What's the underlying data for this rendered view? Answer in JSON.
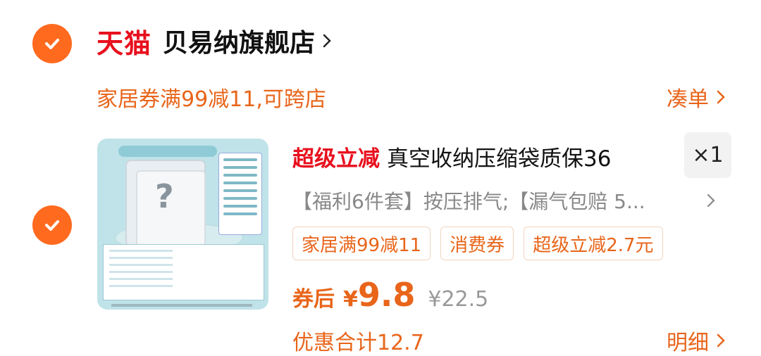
{
  "shop": {
    "logo_text": "天猫",
    "name": "贝易纳旗舰店"
  },
  "coupon_bar": {
    "text": "家居券满99减11,可跨店",
    "action": "凑单"
  },
  "item": {
    "promo_tag": "超级立减",
    "title": "真空收纳压缩袋质保36",
    "quantity": "×1",
    "sku": "【福利6件套】按压排气;【漏气包赔 5...",
    "tags": [
      "家居满99减11",
      "消费券",
      "超级立减2.7元"
    ],
    "price_label": "券后",
    "currency": "¥",
    "price": "9.8",
    "original_price": "¥22.5",
    "discount_total": "优惠合计12.7",
    "detail_link": "明细"
  },
  "colors": {
    "accent": "#ff6a1f",
    "tmall_red": "#e8101e",
    "promo_orange": "#e8651a"
  }
}
